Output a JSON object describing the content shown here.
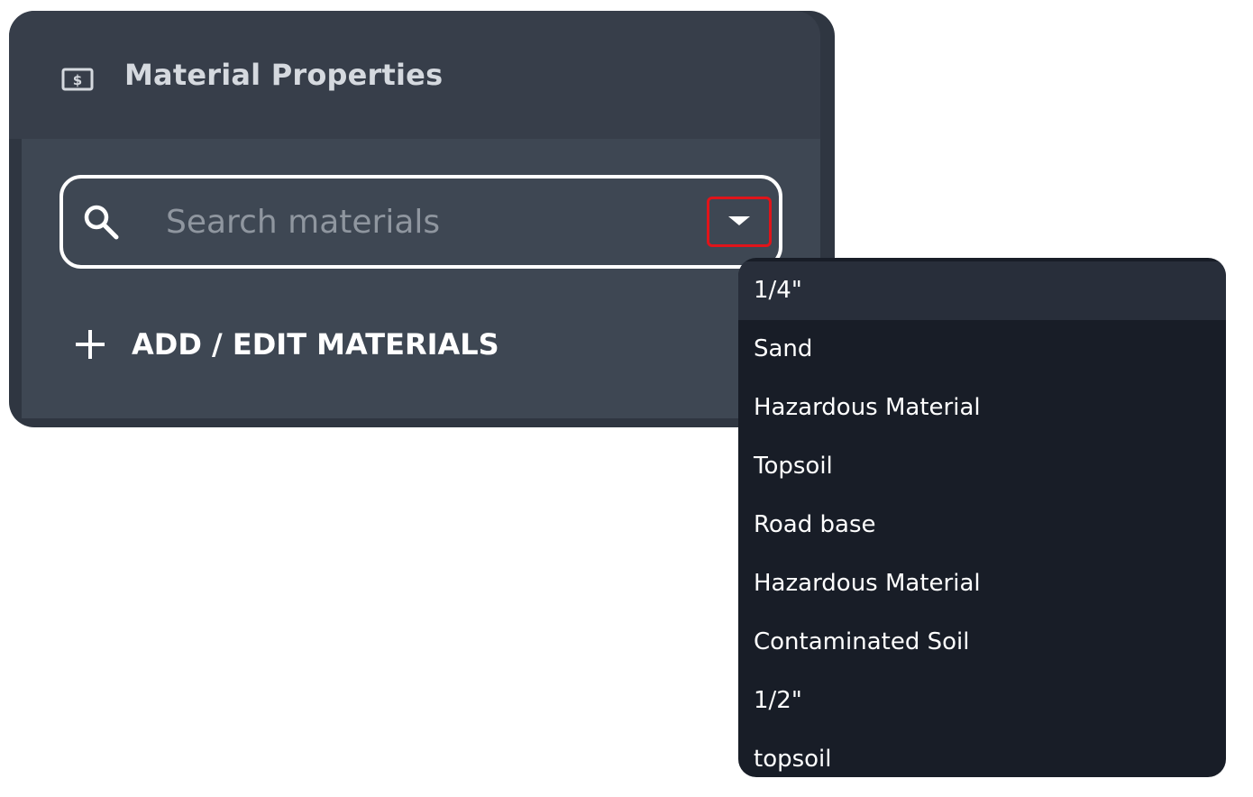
{
  "header": {
    "title": "Material Properties",
    "icon": "dollar-bill-icon",
    "icon_glyph": "$"
  },
  "search": {
    "placeholder": "Search materials",
    "value": "",
    "icon": "search-icon",
    "toggle_icon": "caret-down-icon"
  },
  "actions": {
    "add_edit_label": "ADD / EDIT MATERIALS",
    "add_icon": "plus-icon"
  },
  "dropdown": {
    "options": [
      "1/4\"",
      "Sand",
      "Hazardous Material",
      "Topsoil",
      "Road base",
      "Hazardous Material",
      "Contaminated Soil",
      "1/2\"",
      "topsoil"
    ],
    "highlighted_index": 0
  },
  "colors": {
    "panel_bg": "#2f3641",
    "header_bg": "#373e4a",
    "body_bg": "#3e4753",
    "menu_bg": "#181d27",
    "menu_highlight": "#282e3a",
    "toggle_outline": "#e0141a"
  }
}
